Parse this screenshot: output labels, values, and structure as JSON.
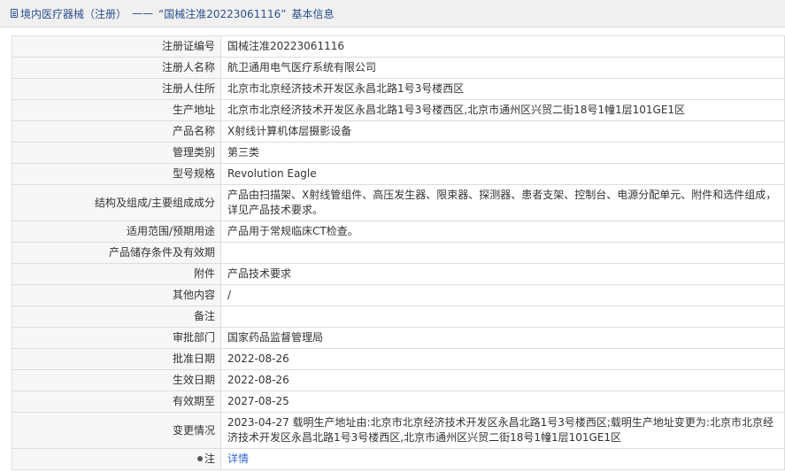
{
  "header": {
    "section": "境内医疗器械（注册）",
    "separator": "——",
    "record": "“国械注准20223061116”",
    "suffix": "基本信息"
  },
  "rows": [
    {
      "label": "注册证编号",
      "value": "国械注准20223061116"
    },
    {
      "label": "注册人名称",
      "value": "航卫通用电气医疗系统有限公司"
    },
    {
      "label": "注册人住所",
      "value": "北京市北京经济技术开发区永昌北路1号3号楼西区"
    },
    {
      "label": "生产地址",
      "value": "北京市北京经济技术开发区永昌北路1号3号楼西区,北京市通州区兴贸二街18号1幢1层101GE1区"
    },
    {
      "label": "产品名称",
      "value": "X射线计算机体层摄影设备"
    },
    {
      "label": "管理类别",
      "value": "第三类"
    },
    {
      "label": "型号规格",
      "value": "Revolution Eagle"
    },
    {
      "label": "结构及组成/主要组成成分",
      "value": "产品由扫描架、X射线管组件、高压发生器、限束器、探测器、患者支架、控制台、电源分配单元、附件和选件组成，详见产品技术要求。"
    },
    {
      "label": "适用范围/预期用途",
      "value": "产品用于常规临床CT检查。"
    },
    {
      "label": "产品储存条件及有效期",
      "value": ""
    },
    {
      "label": "附件",
      "value": "产品技术要求"
    },
    {
      "label": "其他内容",
      "value": "/"
    },
    {
      "label": "备注",
      "value": ""
    },
    {
      "label": "审批部门",
      "value": "国家药品监督管理局"
    },
    {
      "label": "批准日期",
      "value": "2022-08-26"
    },
    {
      "label": "生效日期",
      "value": "2022-08-26"
    },
    {
      "label": "有效期至",
      "value": "2027-08-25"
    },
    {
      "label": "变更情况",
      "value": "2023-04-27 载明生产地址由:北京市北京经济技术开发区永昌北路1号3号楼西区;载明生产地址变更为:北京市北京经济技术开发区永昌北路1号3号楼西区,北京市通州区兴贸二街18号1幢1层101GE1区"
    }
  ],
  "note": {
    "label": "注",
    "link": "详情",
    "icon": "lightbulb-icon"
  },
  "colors": {
    "link": "#3366cc",
    "header_text": "#2b4f8c",
    "label_bg": "#f7f7f7",
    "border": "#dddddd"
  }
}
